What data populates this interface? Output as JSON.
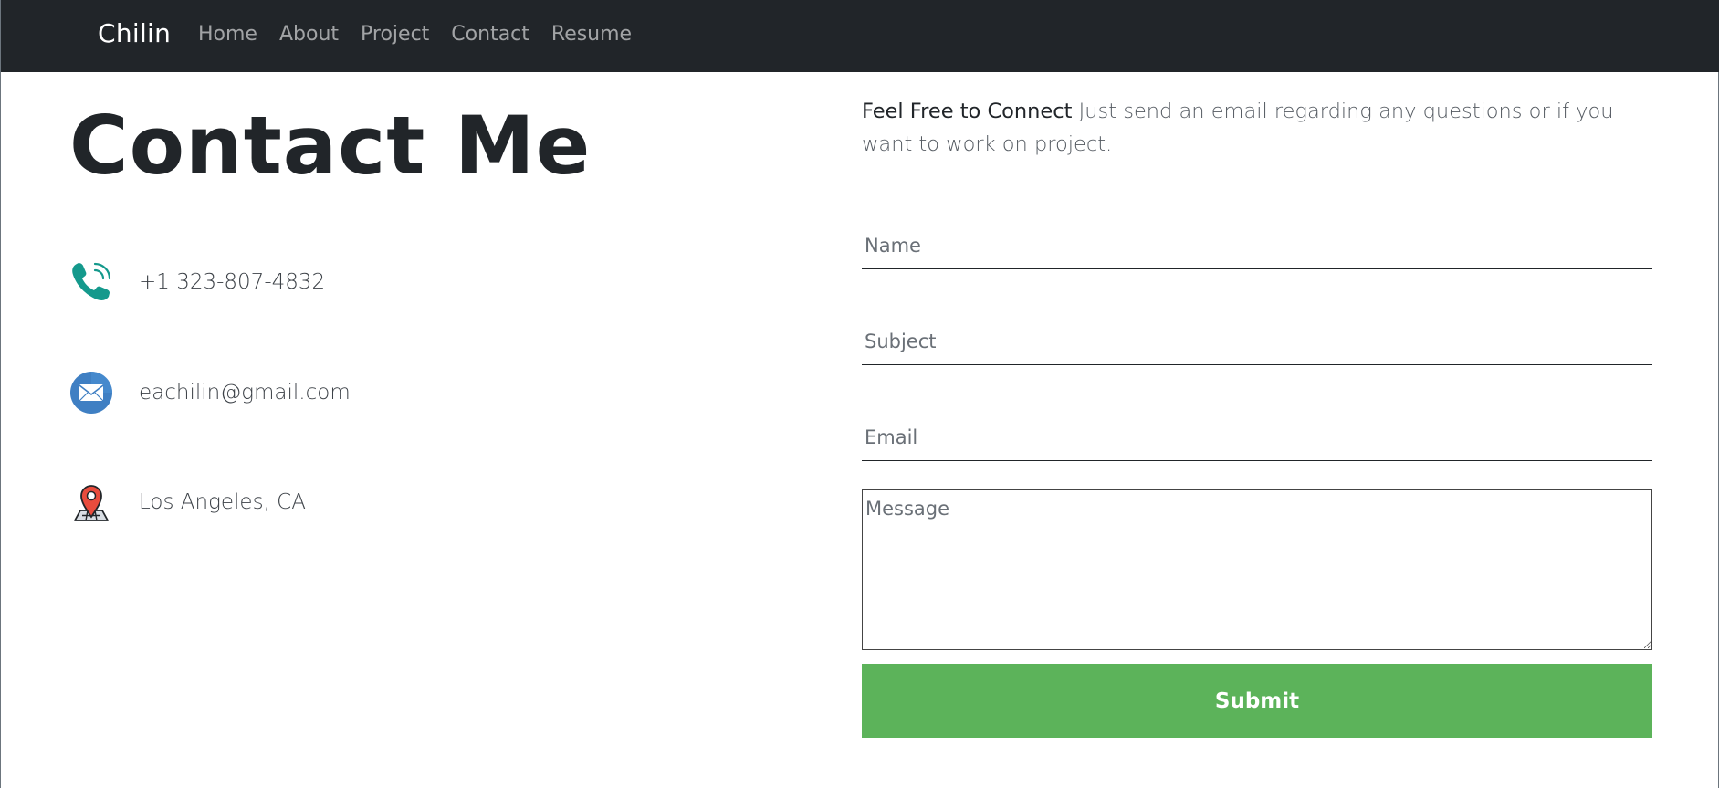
{
  "navbar": {
    "brand": "Chilin",
    "links": [
      "Home",
      "About",
      "Project",
      "Contact",
      "Resume"
    ]
  },
  "contact": {
    "heading": "Contact Me",
    "phone": "+1 323-807-4832",
    "email": "eachilin@gmail.com",
    "location": "Los Angeles, CA"
  },
  "intro": {
    "lead": "Feel Free to Connect",
    "text": " Just send an email regarding any questions or if you want to work on project."
  },
  "form": {
    "name_placeholder": "Name",
    "subject_placeholder": "Subject",
    "email_placeholder": "Email",
    "message_placeholder": "Message",
    "submit_label": "Submit"
  },
  "icons": {
    "phone": "phone-icon",
    "email": "envelope-icon",
    "location": "map-pin-icon"
  },
  "colors": {
    "navbar_bg": "#212529",
    "submit_bg": "#5cb35a",
    "phone_icon": "#14998c",
    "mail_circle": "#3f7fc3",
    "pin_red": "#e84c3d"
  }
}
